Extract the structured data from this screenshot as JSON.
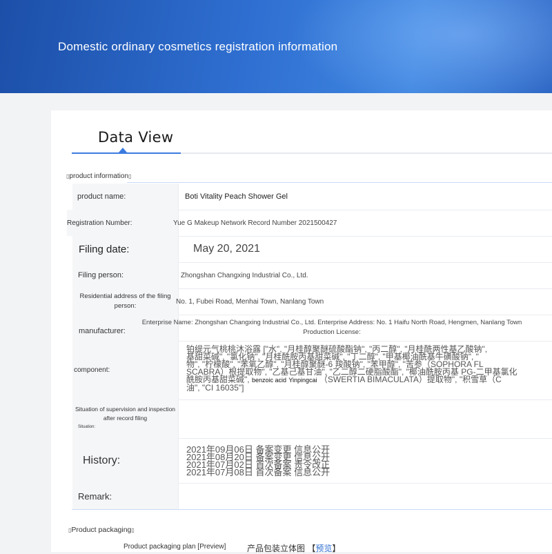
{
  "banner": {
    "title": "Domestic ordinary cosmetics registration information"
  },
  "tab": {
    "title": "Data View"
  },
  "section_product": {
    "title": "product information"
  },
  "rows": {
    "product_name": {
      "label": "product name:",
      "value": "Boti Vitality Peach Shower Gel"
    },
    "registration_number": {
      "label": "Registration Number:",
      "value": "Yue G Makeup Network Record Number 2021500427"
    },
    "filing_date": {
      "label": "Filing date:",
      "value": "May 20, 2021"
    },
    "filing_person": {
      "label": "Filing person:",
      "value": "Zhongshan Changxing Industrial Co., Ltd."
    },
    "residential_address": {
      "label": "Residential address of the filing person:",
      "value": "No. 1, Fubei Road, Menhai Town, Nanlang Town"
    },
    "manufacturer": {
      "label": "manufacturer:",
      "value": "Enterprise Name: Zhongshan Changxing Industrial Co., Ltd. Enterprise Address: No. 1 Haifu North Road, Hengmen, Nanlang Town Production License:"
    },
    "component": {
      "label": "component:",
      "line1": "铂缇元气桃桃沐浴露 [\"水\", \"月桂醇聚醚硫酸酯钠\", \"丙二醇\", \"月桂酰两性基乙酸钠\",",
      "line2": "基甜菜碱\", \"氯化钠\", \"月桂酰胺丙基甜菜碱\", \"丁二醇\", \"甲基椰油酰基牛磺酸钠\", \"",
      "line3": "物\", \"柠檬酸\", \"苯氧乙醇\", \"月桂醇聚醚-6 羧酸钠\", \"苯甲醇\", \"苦参（SOPHORA FL",
      "line4": "SCABRA）根提取物\", \"乙基己基甘油\", \"乙二醇二硬脂酸酯\", \"椰油酰胺丙基 PG-二甲基氯化",
      "line5": "酰胺丙基甜菜碱\",",
      "line5_en1": "benzoic acid",
      "line5_en2": "Yinpingcai",
      "line5_rest": "（SWERTIA BIMACULATA）提取物\", \"积雪草（C",
      "line6": "油\", \"CI 16035\"]"
    },
    "supervision": {
      "label_line1": "Situation of supervision and inspection",
      "label_line2": "after record filing",
      "label_line3": "Situation:"
    },
    "history": {
      "label": "History:",
      "entries": [
        "2021年09月06日 备案变更 信息公开",
        "2021年08月20日 备案变更 信息公开",
        "2021年07月02日 首次备案 责令改正",
        "2021年07月08日 首次备案 信息公开"
      ]
    },
    "remark": {
      "label": "Remark:",
      "value": ""
    }
  },
  "section_packaging": {
    "title": "Product packaging"
  },
  "packaging": {
    "label": "Product packaging plan [Preview]",
    "value": "产品包装立体图 【",
    "preview": "预览",
    "close": "】"
  }
}
